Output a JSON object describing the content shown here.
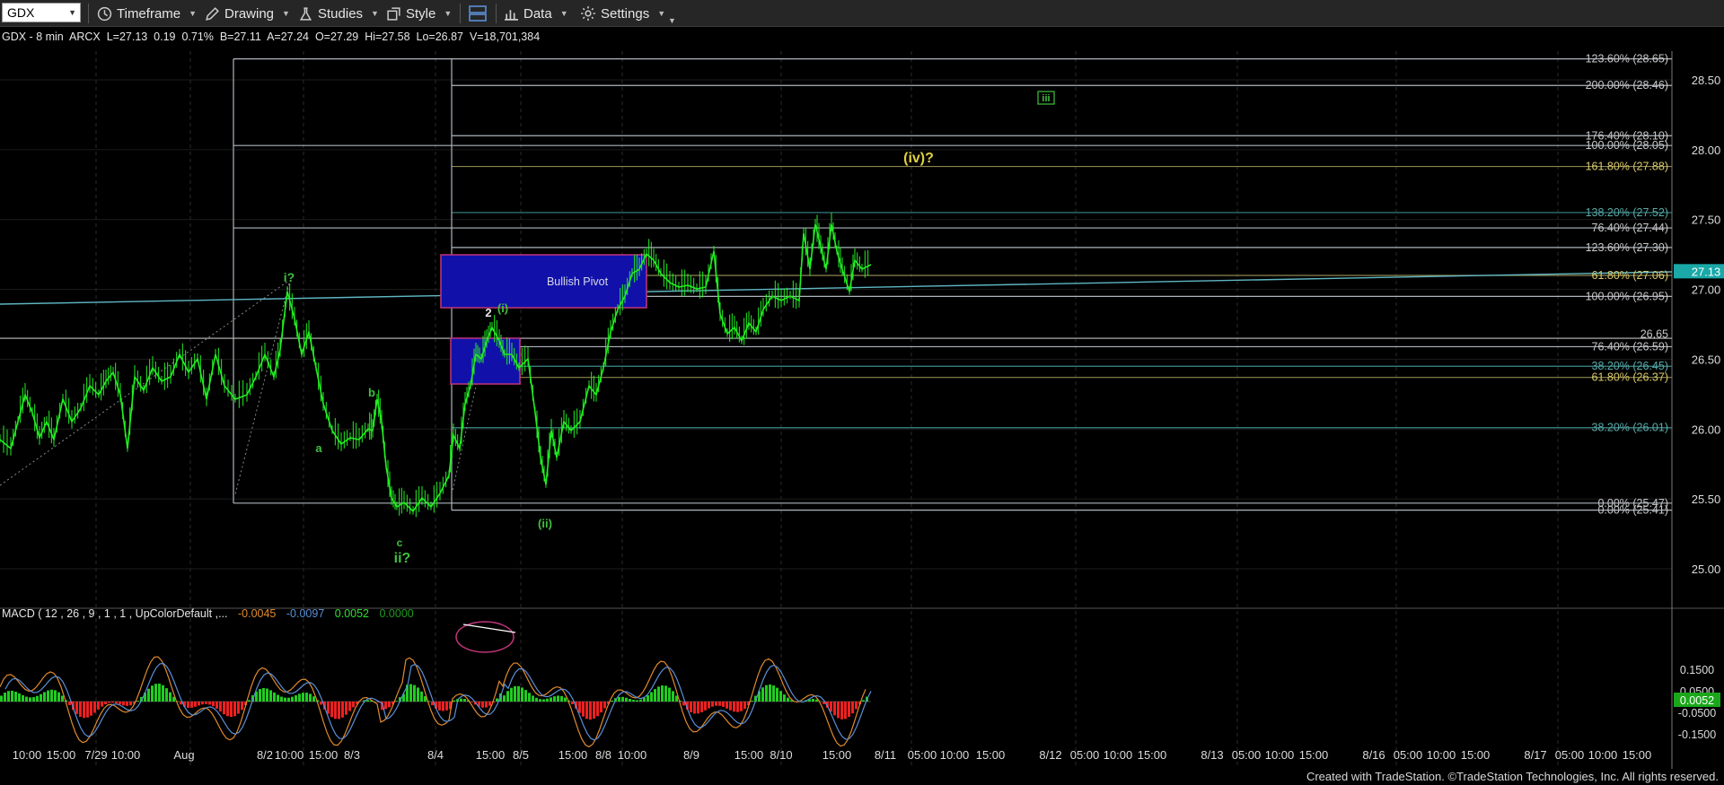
{
  "toolbar": {
    "symbol": "GDX",
    "timeframe_label": "Timeframe",
    "drawing_label": "Drawing",
    "studies_label": "Studies",
    "style_label": "Style",
    "data_label": "Data",
    "settings_label": "Settings"
  },
  "quote_line": "GDX - 8 min  ARCX  L=27.13  0.19  0.71%  B=27.11  A=27.24  O=27.29  Hi=27.58  Lo=26.87  V=18,701,384",
  "macd": {
    "label": "MACD ( 12 , 26 , 9 , 1 , 1 , UpColorDefault ,...",
    "v1": "-0.0045",
    "v2": "-0.0097",
    "v3": "0.0052",
    "v4": "0.0000",
    "color_v1": "#e08a2c",
    "color_v2": "#5b8fd6",
    "color_v3": "#33dd33",
    "color_v4": "#1f9a1f",
    "last_value": "0.0052"
  },
  "price_axis": {
    "labels": [
      "28.50",
      "28.00",
      "27.50",
      "27.00",
      "26.50",
      "26.00",
      "25.50",
      "25.00"
    ],
    "last_price": "27.13"
  },
  "macd_axis": {
    "labels": [
      "0.1500",
      "0.0500",
      "-0.0500",
      "-0.1500"
    ]
  },
  "fib_labels": [
    {
      "text": "123.60% (28.65)",
      "price": 28.65,
      "color": "#c8c8c8"
    },
    {
      "text": "200.00% (28.46)",
      "price": 28.46,
      "color": "#c8c8c8"
    },
    {
      "text": "176.40% (28.10)",
      "price": 28.1,
      "color": "#c8c8c8"
    },
    {
      "text": "100.00% (28.05)",
      "price": 28.03,
      "color": "#c8c8c8"
    },
    {
      "text": "161.80% (27.88)",
      "price": 27.88,
      "color": "#d8c96a"
    },
    {
      "text": "138.20% (27.52)",
      "price": 27.55,
      "color": "#5aa9a9"
    },
    {
      "text": "76.40% (27.44)",
      "price": 27.44,
      "color": "#c8c8c8"
    },
    {
      "text": "123.60% (27.30)",
      "price": 27.3,
      "color": "#c8c8c8"
    },
    {
      "text": "61.80% (27.06)",
      "price": 27.1,
      "color": "#d8c96a"
    },
    {
      "text": "100.00% (26.95)",
      "price": 26.95,
      "color": "#c8c8c8"
    },
    {
      "text": "26.65",
      "price": 26.68,
      "color": "#c8c8c8"
    },
    {
      "text": "76.40% (26.59)",
      "price": 26.59,
      "color": "#c8c8c8"
    },
    {
      "text": "38.20% (26.45)",
      "price": 26.45,
      "color": "#5aa9a9"
    },
    {
      "text": "61.80% (26.37)",
      "price": 26.37,
      "color": "#d8c96a"
    },
    {
      "text": "38.20% (26.01)",
      "price": 26.01,
      "color": "#5aa9a9"
    },
    {
      "text": "0.00% (25.47)",
      "price": 25.47,
      "color": "#c8c8c8"
    },
    {
      "text": "0.00% (25.41)",
      "price": 25.42,
      "color": "#c8c8c8"
    }
  ],
  "wave_labels": [
    {
      "text": "i?",
      "color": "#40c040"
    },
    {
      "text": "a",
      "color": "#40c040"
    },
    {
      "text": "b",
      "color": "#40c040"
    },
    {
      "text": "c",
      "color": "#40c040"
    },
    {
      "text": "ii?",
      "color": "#40c040"
    },
    {
      "text": "2",
      "color": "#e6e6e6"
    },
    {
      "text": "(i)",
      "color": "#40c040"
    },
    {
      "text": "(ii)",
      "color": "#40c040"
    },
    {
      "text": "iii",
      "color": "#40c040"
    },
    {
      "text": "(iv)?",
      "color": "#e0d040"
    }
  ],
  "pivot_label": "Bullish Pivot",
  "time_axis": [
    "10:00",
    "15:00",
    "7/29",
    "10:00",
    "Aug",
    "8/2",
    "10:00",
    "15:00",
    "8/3",
    "8/4",
    "15:00",
    "8/5",
    "15:00",
    "8/8",
    "10:00",
    "8/9",
    "15:00",
    "8/10",
    "15:00",
    "8/11",
    "05:00",
    "10:00",
    "15:00",
    "8/12",
    "05:00",
    "10:00",
    "15:00",
    "8/13",
    "05:00",
    "10:00",
    "15:00",
    "8/16",
    "05:00",
    "10:00",
    "15:00",
    "8/17",
    "05:00",
    "10:00",
    "15:00"
  ],
  "credit": "Created with TradeStation. ©TradeStation Technologies, Inc. All rights reserved.",
  "colors": {
    "price_line": "#22ee22",
    "trendline": "#5fb7c4",
    "pivot_fill": "#1111aa",
    "pivot_border": "#c0357a",
    "macd_up": "#22cc22",
    "macd_down": "#ee2020",
    "macd_line": "#e08a2c",
    "signal_line": "#5b8fd6"
  }
}
